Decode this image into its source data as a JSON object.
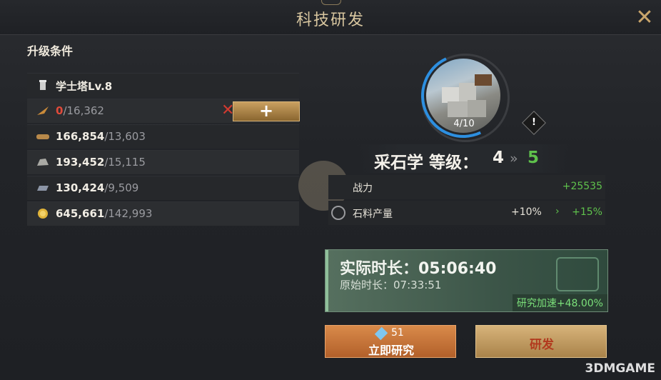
{
  "header": {
    "title": "科技研发",
    "close_label": "✕"
  },
  "conditions": {
    "title": "升级条件",
    "building": {
      "name": "学士塔Lv.8",
      "icon": "tower-icon"
    },
    "resources": [
      {
        "icon": "feather-icon",
        "current": "0",
        "need": "/16,362",
        "insufficient": true
      },
      {
        "icon": "wood-icon",
        "current": "166,854",
        "need": "/13,603",
        "insufficient": false
      },
      {
        "icon": "stone-icon",
        "current": "193,452",
        "need": "/15,115",
        "insufficient": false
      },
      {
        "icon": "iron-icon",
        "current": "130,424",
        "need": "/9,509",
        "insufficient": false
      },
      {
        "icon": "gold-icon",
        "current": "645,661",
        "need": "/142,993",
        "insufficient": false
      }
    ],
    "add_button_label": "+",
    "cross_mark": "✕"
  },
  "tech": {
    "progress": "4/10",
    "name": "采石学 等级：",
    "level_from": "4",
    "level_arrow": "»",
    "level_to": "5",
    "warning": "!"
  },
  "stats": [
    {
      "label": "战力",
      "current": "",
      "arrow": "",
      "next": "+25535"
    },
    {
      "label": "石料产量",
      "current": "+10%",
      "arrow": "›",
      "next": "+15%"
    }
  ],
  "time": {
    "actual_label": "实际时长：05:06:40",
    "original_label": "原始时长：07:33:51",
    "speedup": "研究加速+48.00%"
  },
  "buttons": {
    "instant": {
      "cost": "51",
      "label": "立即研究"
    },
    "research": {
      "label": "研发"
    }
  },
  "watermark": "3DMGAME",
  "colors": {
    "accent": "#d9c7a0",
    "green": "#5fc24c",
    "red": "#e04a3a",
    "blue_ring": "#2d8fe0"
  }
}
